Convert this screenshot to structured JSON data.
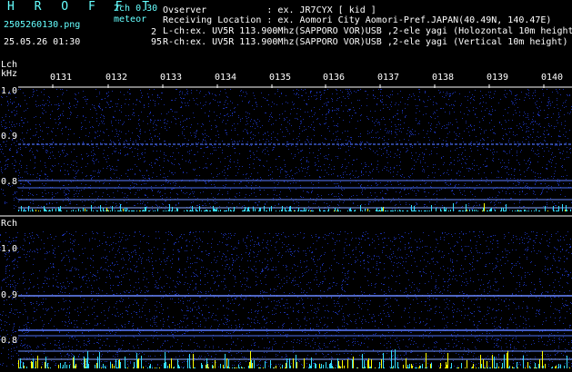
{
  "header": {
    "app_title": "H R O F F T",
    "channel_mode": "2ch 0.30",
    "meteor_label": "meteor",
    "file_name": "2505260130.png",
    "count_l": "2",
    "timestamp": "25.05.26 01:30",
    "count_r": "95",
    "observer_line": "Ovserver           : ex. JR7CYX [ kid ]",
    "location_line": "Receiving Location : ex. Aomori City Aomori-Pref.JAPAN(40.49N, 140.47E)",
    "lch_line": "L-ch:ex. UV5R 113.900Mhz(SAPPORO VOR)USB ,2-ele yagi (Holozontal 10m height)",
    "rch_line": "R-ch:ex. UV5R 113.900Mhz(SAPPORO VOR)USB ,2-ele yagi (Vertical 10m height)"
  },
  "lch_panel": {
    "label": "Lch",
    "unit": "kHz",
    "y_ticks": [
      "1.0",
      "0.9",
      "0.8"
    ]
  },
  "rch_panel": {
    "label": "Rch",
    "y_ticks": [
      "1.0",
      "0.9",
      "0.8"
    ]
  },
  "time_ticks": [
    "0131",
    "0132",
    "0133",
    "0134",
    "0135",
    "0136",
    "0137",
    "0138",
    "0139",
    "0140"
  ],
  "colors": {
    "background": "#000000",
    "noise": "#1a2fa8",
    "carrier": "#6a88ff",
    "text_cyan": "#66ffff",
    "bar_cyan": "#33ddff",
    "bar_yellow": "#ffff00"
  }
}
